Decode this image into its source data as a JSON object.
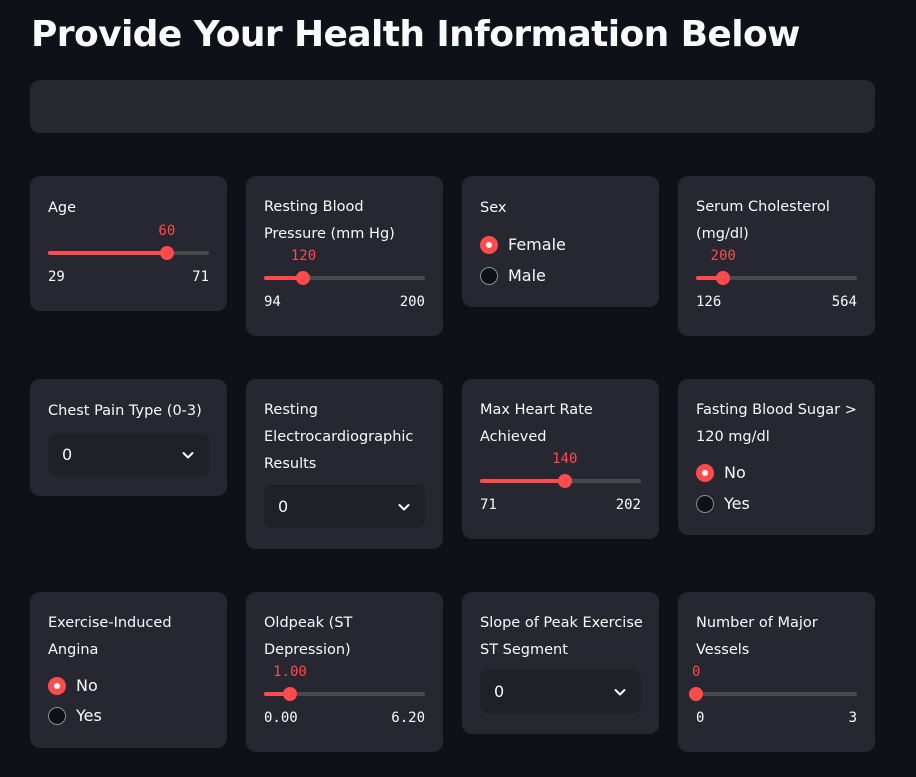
{
  "page": {
    "title": "Provide Your Health Information Below"
  },
  "fields": {
    "age": {
      "label": "Age",
      "value": "60",
      "min": "29",
      "max": "71",
      "fraction": 0.7381
    },
    "bp": {
      "label": "Resting Blood Pressure (mm Hg)",
      "value": "120",
      "min": "94",
      "max": "200",
      "fraction": 0.2453
    },
    "sex": {
      "label": "Sex",
      "options": [
        "Female",
        "Male"
      ],
      "selected": "Female"
    },
    "chol": {
      "label": "Serum Cholesterol (mg/dl)",
      "value": "200",
      "min": "126",
      "max": "564",
      "fraction": 0.1689
    },
    "cp": {
      "label": "Chest Pain Type (0-3)",
      "selected": "0"
    },
    "ecg": {
      "label": "Resting Electrocardiographic Results",
      "selected": "0"
    },
    "hr": {
      "label": "Max Heart Rate Achieved",
      "value": "140",
      "min": "71",
      "max": "202",
      "fraction": 0.5267
    },
    "fbs": {
      "label": "Fasting Blood Sugar > 120 mg/dl",
      "options": [
        "No",
        "Yes"
      ],
      "selected": "No"
    },
    "angina": {
      "label": "Exercise-Induced Angina",
      "options": [
        "No",
        "Yes"
      ],
      "selected": "No"
    },
    "oldpeak": {
      "label": "Oldpeak (ST Depression)",
      "value": "1.00",
      "min": "0.00",
      "max": "6.20",
      "fraction": 0.1613
    },
    "slope": {
      "label": "Slope of Peak Exercise ST Segment",
      "selected": "0"
    },
    "vessels": {
      "label": "Number of Major Vessels",
      "value": "0",
      "min": "0",
      "max": "3",
      "fraction": 0.0
    }
  },
  "colors": {
    "accent": "#ff4b4b",
    "background": "#0e1117",
    "card": "#262730"
  },
  "icons": {
    "select_arrow": "chevron-down-icon"
  }
}
